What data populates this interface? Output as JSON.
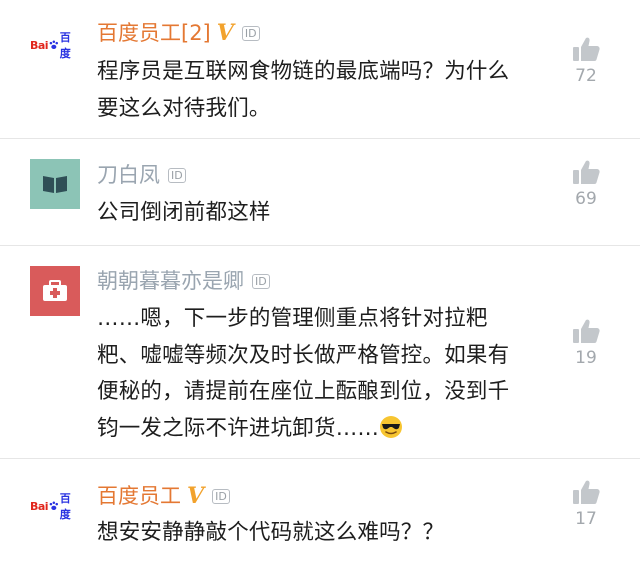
{
  "colors": {
    "official_name": "#e47833",
    "normal_name": "#9aa5b0",
    "vip_badge": "#f2a22c",
    "like_icon": "#c3c7cb",
    "like_count": "#a3a8ad",
    "divider": "#e6e6e6"
  },
  "comments": [
    {
      "avatar_icon": "baidu-logo-icon",
      "avatar_text": {
        "bai": "Bai",
        "du": "百度"
      },
      "username": "百度员工[2]",
      "vip_badge": "V",
      "id_badge": "ID",
      "text_lines": [
        "程序员是互联网食物链的最底端吗？为什么",
        "要这么对待我们。"
      ],
      "likes": "72"
    },
    {
      "avatar_icon": "book-icon",
      "username": "刀白凤",
      "id_badge": "ID",
      "text_lines": [
        "公司倒闭前都这样"
      ],
      "likes": "69"
    },
    {
      "avatar_icon": "medical-kit-icon",
      "username": "朝朝暮暮亦是卿",
      "id_badge": "ID",
      "text_lines": [
        "……嗯，下一步的管理侧重点将针对拉粑",
        "粑、嘘嘘等频次及时长做严格管控。如果有",
        "便秘的，请提前在座位上酝酿到位，没到千",
        "钧一发之际不许进坑卸货……"
      ],
      "trailing_emoji": "sunglasses-emoji-icon",
      "likes": "19"
    },
    {
      "avatar_icon": "baidu-logo-icon",
      "avatar_text": {
        "bai": "Bai",
        "du": "百度"
      },
      "username": "百度员工",
      "vip_badge": "V",
      "id_badge": "ID",
      "text_lines": [
        "想安安静静敲个代码就这么难吗？？"
      ],
      "likes": "17"
    }
  ]
}
